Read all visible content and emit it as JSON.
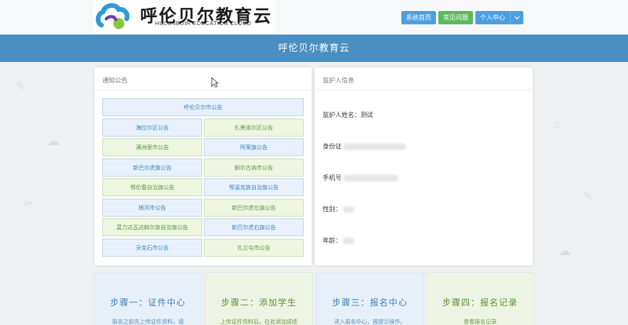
{
  "header": {
    "logo_title": "呼伦贝尔教育云",
    "logo_subtitle": "HULUNBUIR EDUCATION CLOUD",
    "nav": {
      "home": "系统首页",
      "faq": "常见问题",
      "user_center": "个人中心"
    }
  },
  "banner": {
    "title": "呼伦贝尔教育云"
  },
  "notice": {
    "title": "通知公告",
    "top": "呼伦贝尔市公告",
    "items": [
      "海拉尔区公告",
      "扎赉诺尔区公告",
      "满洲里市公告",
      "阿荣旗公告",
      "新巴尔虎旗公告",
      "额尔古纳市公告",
      "鄂伦春自治旗公告",
      "鄂温克族自治旗公告",
      "根河市公告",
      "新巴尔虎左旗公告",
      "莫力达瓦达斡尔族自治旗公告",
      "新巴尔虎右旗公告",
      "牙克石市公告",
      "扎兰屯市公告"
    ]
  },
  "guardian": {
    "title": "监护人信息",
    "name_label": "监护人姓名：",
    "name_value": "测试",
    "id_label": "身份证",
    "phone_label": "手机号",
    "gender_label": "性别：",
    "age_label": "年龄："
  },
  "steps": [
    {
      "title": "步骤一：证件中心",
      "desc": "报名之前先上传证件资料，填"
    },
    {
      "title": "步骤二：添加学生",
      "desc": "上传证件资料后，在此添加成绩"
    },
    {
      "title": "步骤三：报名中心",
      "desc": "进入报名中心，按提示操作。"
    },
    {
      "title": "步骤四：报名记录",
      "desc": "查看报名记录"
    }
  ],
  "colors": {
    "banner": "#4b8fc2",
    "primary_button": "#4a9fe3",
    "success_button": "#5cb85c"
  }
}
